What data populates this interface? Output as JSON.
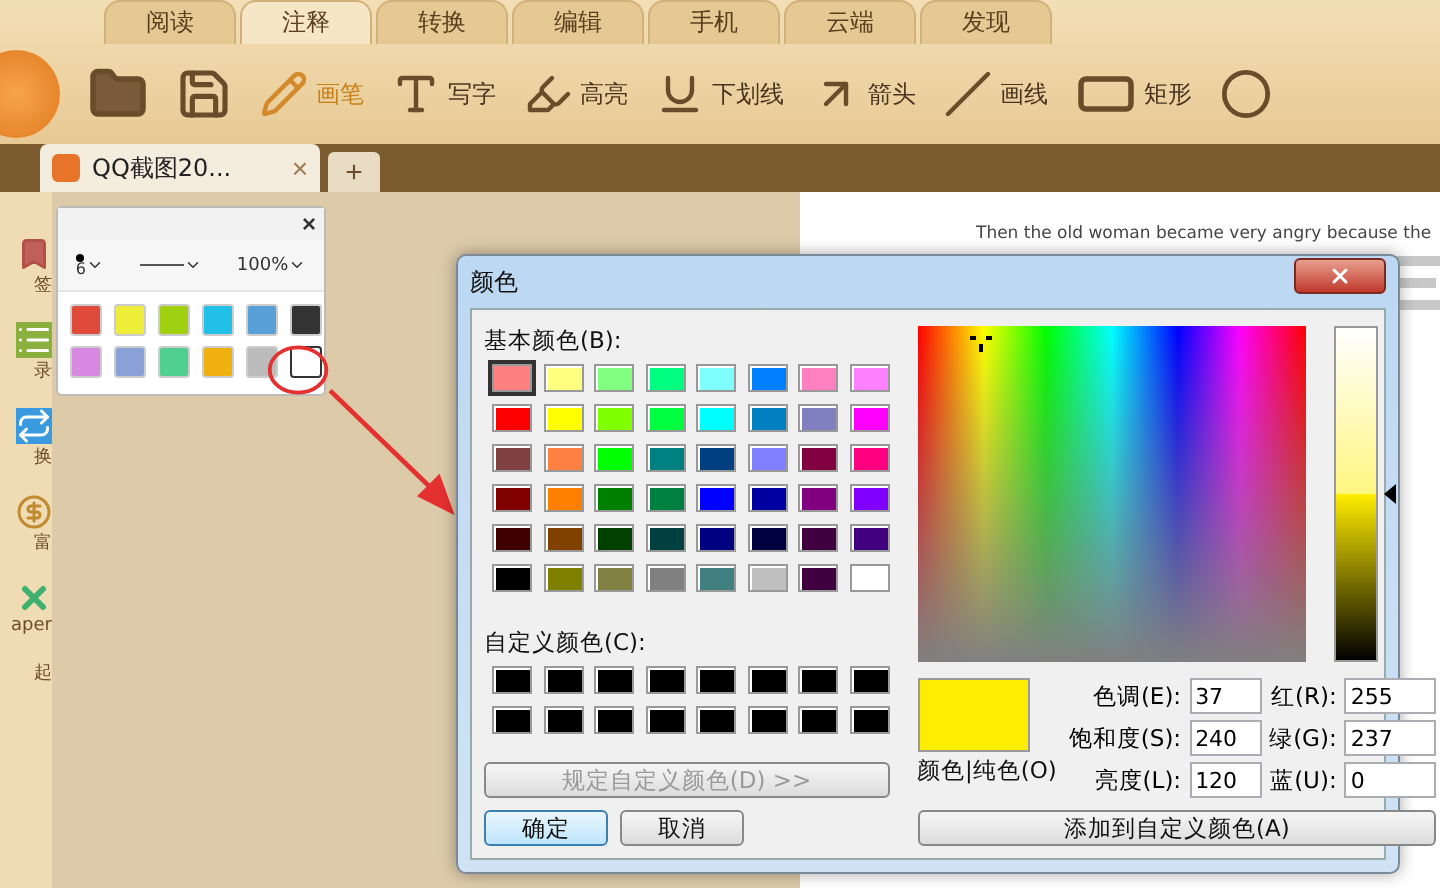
{
  "ribbon_tabs": [
    {
      "label": "阅读",
      "selected": false
    },
    {
      "label": "注释",
      "selected": true
    },
    {
      "label": "转换",
      "selected": false
    },
    {
      "label": "编辑",
      "selected": false
    },
    {
      "label": "手机",
      "selected": false
    },
    {
      "label": "云端",
      "selected": false
    },
    {
      "label": "发现",
      "selected": false
    }
  ],
  "toolbar": [
    {
      "kind": "folder"
    },
    {
      "kind": "save"
    },
    {
      "kind": "pen",
      "label": "画笔",
      "selected": true
    },
    {
      "kind": "text",
      "label": "写字",
      "selected": false
    },
    {
      "kind": "highlight",
      "label": "高亮",
      "selected": false
    },
    {
      "kind": "underline",
      "label": "下划线",
      "selected": false
    },
    {
      "kind": "arrow",
      "label": "箭头",
      "selected": false
    },
    {
      "kind": "line",
      "label": "画线",
      "selected": false
    },
    {
      "kind": "rect",
      "label": "矩形",
      "selected": false
    },
    {
      "kind": "ellipse"
    }
  ],
  "doc_tab": {
    "title": "QQ截图20...",
    "close": "×",
    "new_tab": "+"
  },
  "sidebar": [
    {
      "kind": "bookmark",
      "label": "签"
    },
    {
      "kind": "list",
      "label": "录"
    },
    {
      "kind": "convert",
      "label": "换"
    },
    {
      "kind": "money",
      "label": "富"
    },
    {
      "kind": "paper",
      "label": "aper"
    },
    {
      "kind": "none",
      "label": "起"
    }
  ],
  "pen_popup": {
    "close": "×",
    "size": "6",
    "opacity": "100%",
    "colors": [
      {
        "color": "#e04a3a",
        "selected": false
      },
      {
        "color": "#eeee3a",
        "selected": false
      },
      {
        "color": "#a0d010",
        "selected": false
      },
      {
        "color": "#20c0e8",
        "selected": false
      },
      {
        "color": "#5aa0d8",
        "selected": false
      },
      {
        "color": "#333333",
        "selected": false
      },
      {
        "color": "#d888e0",
        "selected": false
      },
      {
        "color": "#8ca0d8",
        "selected": false
      },
      {
        "color": "#50d090",
        "selected": false
      },
      {
        "color": "#f0b010",
        "selected": false
      },
      {
        "color": "#bbbbbb",
        "selected": false
      },
      {
        "color": "#ffffff",
        "selected": true
      }
    ]
  },
  "document": {
    "line": "Then the old woman became very angry because the"
  },
  "color_dialog": {
    "title": "颜色",
    "basic_label": "基本颜色(B):",
    "basic_colors": [
      {
        "color": "#ff8080",
        "selected": true
      },
      {
        "color": "#ffff80",
        "selected": false
      },
      {
        "color": "#80ff80",
        "selected": false
      },
      {
        "color": "#00ff80",
        "selected": false
      },
      {
        "color": "#80ffff",
        "selected": false
      },
      {
        "color": "#0080ff",
        "selected": false
      },
      {
        "color": "#ff80c0",
        "selected": false
      },
      {
        "color": "#ff80ff",
        "selected": false
      },
      {
        "color": "#ff0000",
        "selected": false
      },
      {
        "color": "#ffff00",
        "selected": false
      },
      {
        "color": "#80ff00",
        "selected": false
      },
      {
        "color": "#00ff40",
        "selected": false
      },
      {
        "color": "#00ffff",
        "selected": false
      },
      {
        "color": "#0080c0",
        "selected": false
      },
      {
        "color": "#8080c0",
        "selected": false
      },
      {
        "color": "#ff00ff",
        "selected": false
      },
      {
        "color": "#804040",
        "selected": false
      },
      {
        "color": "#ff8040",
        "selected": false
      },
      {
        "color": "#00ff00",
        "selected": false
      },
      {
        "color": "#008080",
        "selected": false
      },
      {
        "color": "#004080",
        "selected": false
      },
      {
        "color": "#8080ff",
        "selected": false
      },
      {
        "color": "#800040",
        "selected": false
      },
      {
        "color": "#ff0080",
        "selected": false
      },
      {
        "color": "#800000",
        "selected": false
      },
      {
        "color": "#ff8000",
        "selected": false
      },
      {
        "color": "#008000",
        "selected": false
      },
      {
        "color": "#008040",
        "selected": false
      },
      {
        "color": "#0000ff",
        "selected": false
      },
      {
        "color": "#0000a0",
        "selected": false
      },
      {
        "color": "#800080",
        "selected": false
      },
      {
        "color": "#8000ff",
        "selected": false
      },
      {
        "color": "#400000",
        "selected": false
      },
      {
        "color": "#804000",
        "selected": false
      },
      {
        "color": "#004000",
        "selected": false
      },
      {
        "color": "#004040",
        "selected": false
      },
      {
        "color": "#000080",
        "selected": false
      },
      {
        "color": "#000040",
        "selected": false
      },
      {
        "color": "#400040",
        "selected": false
      },
      {
        "color": "#400080",
        "selected": false
      },
      {
        "color": "#000000",
        "selected": false
      },
      {
        "color": "#808000",
        "selected": false
      },
      {
        "color": "#808040",
        "selected": false
      },
      {
        "color": "#808080",
        "selected": false
      },
      {
        "color": "#408080",
        "selected": false
      },
      {
        "color": "#c0c0c0",
        "selected": false
      },
      {
        "color": "#400040",
        "selected": false
      },
      {
        "color": "#ffffff",
        "selected": false
      }
    ],
    "custom_label": "自定义颜色(C):",
    "custom_colors": [
      {
        "color": "#000000"
      },
      {
        "color": "#000000"
      },
      {
        "color": "#000000"
      },
      {
        "color": "#000000"
      },
      {
        "color": "#000000"
      },
      {
        "color": "#000000"
      },
      {
        "color": "#000000"
      },
      {
        "color": "#000000"
      },
      {
        "color": "#000000"
      },
      {
        "color": "#000000"
      },
      {
        "color": "#000000"
      },
      {
        "color": "#000000"
      },
      {
        "color": "#000000"
      },
      {
        "color": "#000000"
      },
      {
        "color": "#000000"
      },
      {
        "color": "#000000"
      }
    ],
    "define_button": {
      "label": "规定自定义颜色(D) >>",
      "disabled": true
    },
    "ok_button": "确定",
    "cancel_button": "取消",
    "luminance_slider": {
      "level": 0.5
    },
    "preview": {
      "color": "#ffed00",
      "label": "颜色|纯色(O)"
    },
    "fields": [
      {
        "label": "色调(E):",
        "value": "37"
      },
      {
        "label": "红(R):",
        "value": "255"
      },
      {
        "label": "饱和度(S):",
        "value": "240"
      },
      {
        "label": "绿(G):",
        "value": "237"
      },
      {
        "label": "亮度(L):",
        "value": "120"
      },
      {
        "label": "蓝(U):",
        "value": "0"
      }
    ],
    "add_button": "添加到自定义颜色(A)"
  }
}
